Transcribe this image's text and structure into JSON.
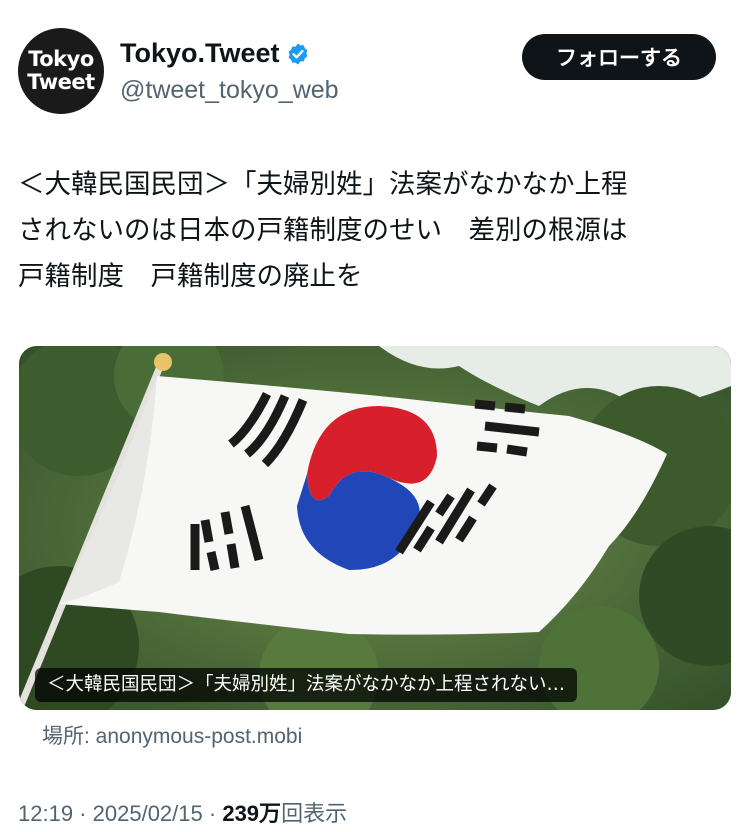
{
  "account": {
    "avatar_line1": "Tokyo",
    "avatar_line2": "Tweet",
    "display_name": "Tokyo.Tweet",
    "handle": "@tweet_tokyo_web",
    "verified": true,
    "follow_label": "フォローする"
  },
  "tweet": {
    "text": "＜大韓民国民団＞「夫婦別姓」法案がなかなか上程\nされないのは日本の戸籍制度のせい　差別の根源は\n戸籍制度　戸籍制度の廃止を"
  },
  "card": {
    "image_subject": "south-korean-flag",
    "caption": "＜大韓民国民団＞「夫婦別姓」法案がなかなか上程されない…",
    "source": "場所: anonymous-post.mobi"
  },
  "meta": {
    "time": "12:19",
    "date": "2025/02/15",
    "views_number": "239",
    "views_unit": "万",
    "views_suffix": "回表示",
    "separator": "·"
  },
  "colors": {
    "text_primary": "#0f1419",
    "text_secondary": "#536471",
    "verified_blue": "#1d9bf0",
    "flag_red": "#d8202c",
    "flag_blue": "#2046b8"
  }
}
